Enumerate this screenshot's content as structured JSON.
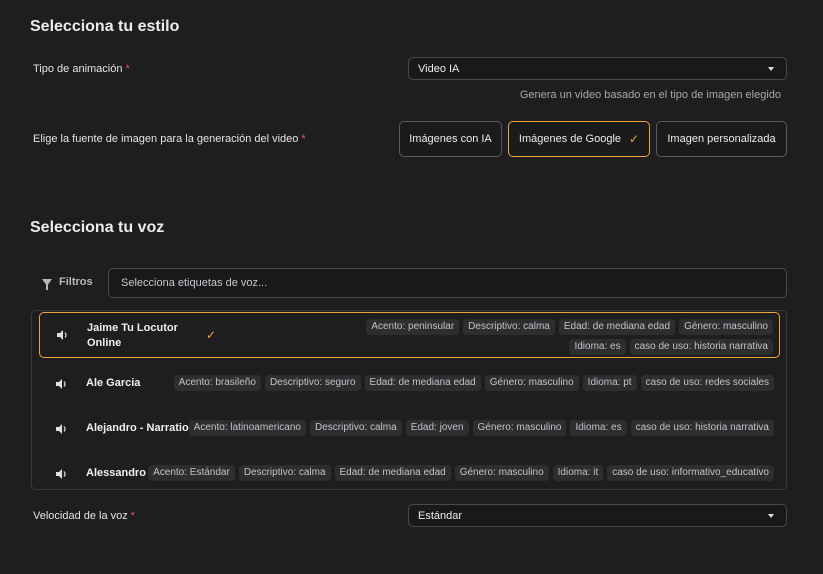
{
  "style_section": {
    "title": "Selecciona tu estilo",
    "animation_label": "Tipo de animación",
    "animation_value": "Video IA",
    "animation_helper": "Genera un video basado en el tipo de imagen elegido",
    "source_label": "Elige la fuente de imagen para la generación del video",
    "source_options": [
      {
        "label": "Imágenes con IA",
        "selected": false
      },
      {
        "label": "Imágenes de Google",
        "selected": true
      },
      {
        "label": "Imagen personalizada",
        "selected": false
      }
    ]
  },
  "voice_section": {
    "title": "Selecciona tu voz",
    "filter_label": "Filtros",
    "filter_placeholder": "Selecciona etiquetas de voz...",
    "voices": [
      {
        "name": "Jaime Tu Locutor Online",
        "selected": true,
        "tags": [
          "Acento: peninsular",
          "Descriptivo: calma",
          "Edad: de mediana edad",
          "Género: masculino",
          "Idioma: es",
          "caso de uso: historia narrativa"
        ]
      },
      {
        "name": "Ale Garcia",
        "selected": false,
        "tags": [
          "Acento: brasileño",
          "Descriptivo: seguro",
          "Edad: de mediana edad",
          "Género: masculino",
          "Idioma: pt",
          "caso de uso: redes sociales"
        ]
      },
      {
        "name": "Alejandro - Narrations",
        "selected": false,
        "tags": [
          "Acento: latinoamericano",
          "Descriptivo: calma",
          "Edad: joven",
          "Género: masculino",
          "Idioma: es",
          "caso de uso: historia narrativa"
        ]
      },
      {
        "name": "Alessandro",
        "selected": false,
        "tags": [
          "Acento: Estándar",
          "Descriptivo: calma",
          "Edad: de mediana edad",
          "Género: masculino",
          "Idioma: it",
          "caso de uso: informativo_educativo"
        ]
      }
    ],
    "speed_label": "Velocidad de la voz",
    "speed_value": "Estándar"
  },
  "required_mark": "*",
  "check_glyph": "✓",
  "colors": {
    "accent": "#f0a43a",
    "required": "#f0525e",
    "background": "#1e1e20"
  }
}
